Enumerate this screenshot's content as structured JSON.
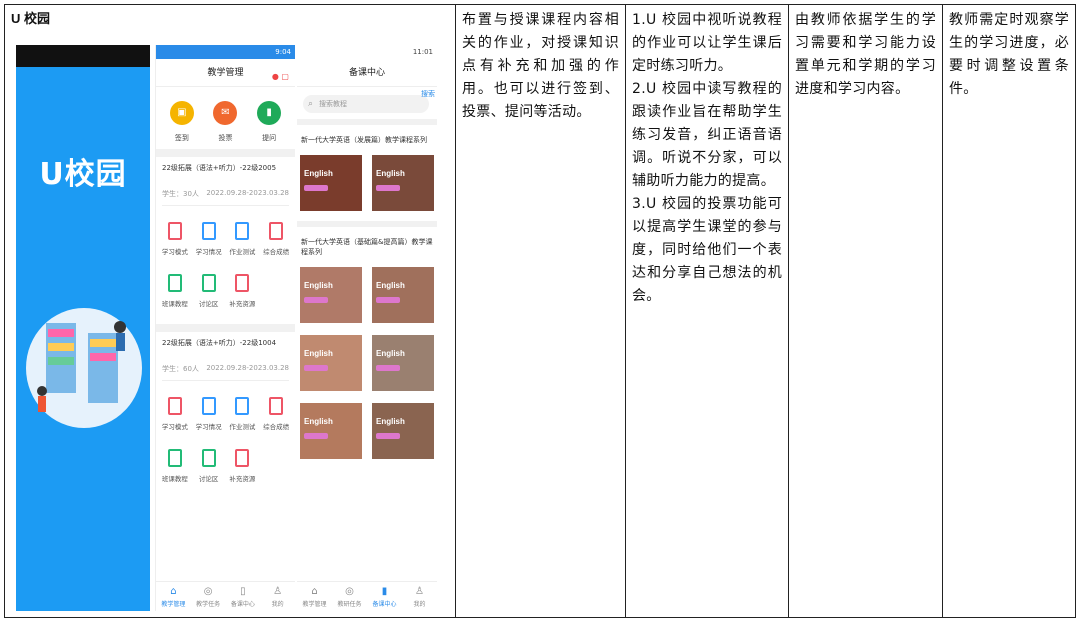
{
  "col1": {
    "title": "U 校园",
    "splash": {
      "logo": "U校园"
    },
    "teaching": {
      "header": "教学管理",
      "shortcuts": [
        "签到",
        "投票",
        "提问"
      ],
      "courses": [
        {
          "name": "22级拓展（语法+听力）-22级2005",
          "students": "学生：30人",
          "dates": "2022.09.28-2023.03.28"
        },
        {
          "name": "22级拓展（语法+听力）-22级1004",
          "students": "学生：60人",
          "dates": "2022.09.28-2023.03.28"
        }
      ],
      "grid": [
        "学习模式",
        "学习情况",
        "作业测试",
        "综合成绩",
        "班课教程",
        "讨论区",
        "补充资源"
      ],
      "tabs": [
        "教学管理",
        "教学任务",
        "备课中心",
        "我的"
      ]
    },
    "prep": {
      "header": "备课中心",
      "search_placeholder": "搜索教程",
      "search_button": "搜索",
      "series": [
        "新一代大学英语（发展篇）教学课程系列",
        "新一代大学英语（基础篇&提高篇）教学课程系列"
      ],
      "thumb_label": "English",
      "tabs": [
        "教学管理",
        "教研任务",
        "备课中心",
        "我的"
      ]
    }
  },
  "col2": {
    "text": "布置与授课课程内容相关的作业，对授课知识点有补充和加强的作用。也可以进行签到、投票、提问等活动。"
  },
  "col3": {
    "paras": [
      "1.U 校园中视听说教程的作业可以让学生课后定时练习听力。",
      "2.U 校园中读写教程的跟读作业旨在帮助学生练习发音，纠正语音语调。听说不分家，可以辅助听力能力的提高。",
      "3.U 校园的投票功能可以提高学生课堂的参与度，同时给他们一个表达和分享自己想法的机会。"
    ]
  },
  "col4": {
    "text": "由教师依据学生的学习需要和学习能力设置单元和学期的学习进度和学习内容。"
  },
  "col5": {
    "text": "教师需定时观察学生的学习进度，必要时调整设置条件。"
  }
}
